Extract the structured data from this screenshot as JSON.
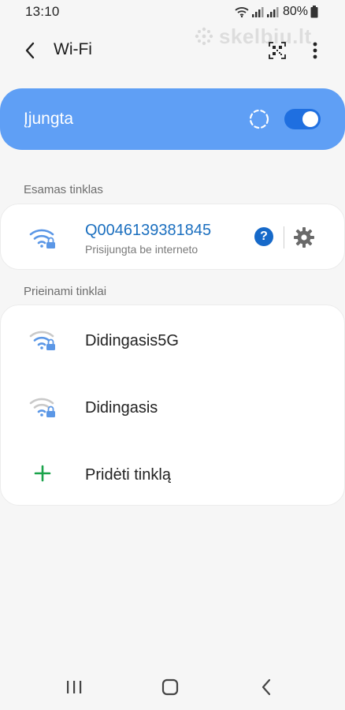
{
  "status_bar": {
    "time": "13:10",
    "battery": "80%"
  },
  "watermark": "skelbiu.lt",
  "app_bar": {
    "title": "Wi-Fi"
  },
  "master": {
    "label": "Įjungta",
    "enabled": true
  },
  "current_section": {
    "header": "Esamas tinklas",
    "ssid": "Q0046139381845",
    "status": "Prisijungta be interneto"
  },
  "available_section": {
    "header": "Prieinami tinklai",
    "networks": [
      {
        "ssid": "Didingasis5G"
      },
      {
        "ssid": "Didingasis"
      }
    ],
    "add_network_label": "Pridėti tinklą"
  },
  "icon_help": "?",
  "colors": {
    "accent": "#5f9ff5",
    "toggle": "#1f6fe0",
    "link": "#1b6fbf",
    "add": "#1aa34a"
  }
}
